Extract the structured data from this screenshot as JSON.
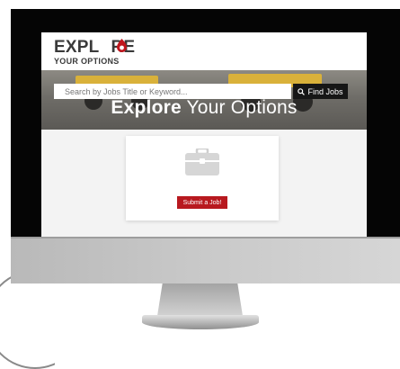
{
  "logo": {
    "main_left": "EXPL",
    "main_right": "RE",
    "sub": "YOUR OPTIONS",
    "flame_color": "#c0161d"
  },
  "hero": {
    "title_bold": "Explore",
    "title_rest": " Your Options"
  },
  "search": {
    "placeholder": "Search by Jobs Title or Keyword...",
    "button_label": "Find Jobs",
    "button_icon": "search-icon"
  },
  "card": {
    "icon": "briefcase-icon",
    "submit_label": "Submit a Job!"
  },
  "colors": {
    "accent": "#b8191f",
    "button_dark": "#161616"
  }
}
